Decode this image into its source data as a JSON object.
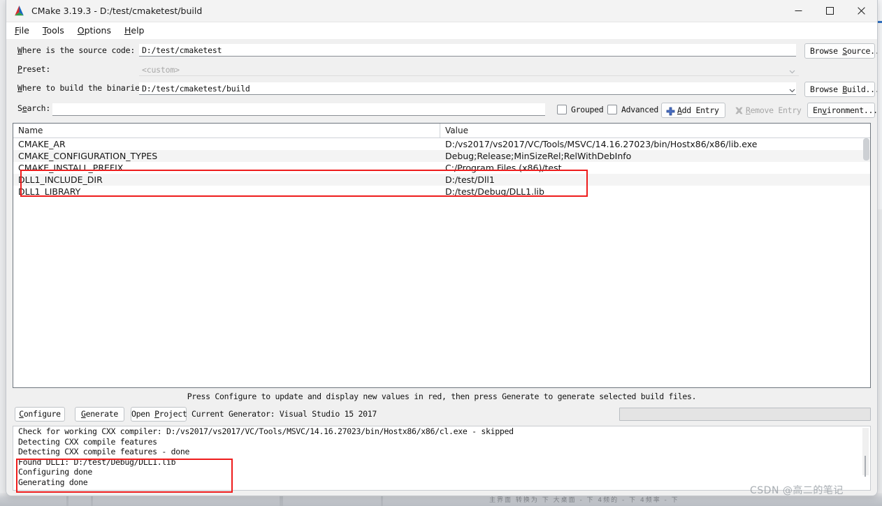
{
  "window": {
    "title": "CMake 3.19.3 - D:/test/cmaketest/build",
    "logo_icon": "cmake-triangle-logo",
    "minimize_icon": "minimize-icon",
    "maximize_icon": "maximize-icon",
    "close_icon": "close-icon"
  },
  "menubar": {
    "items": [
      {
        "label": "File",
        "mnemonic": "F"
      },
      {
        "label": "Tools",
        "mnemonic": "T"
      },
      {
        "label": "Options",
        "mnemonic": "O"
      },
      {
        "label": "Help",
        "mnemonic": "H"
      }
    ]
  },
  "form": {
    "source_label": "Where is the source code:",
    "source_label_pre": "",
    "source_label_mnemonic": "W",
    "source_label_post": "here is the source code:",
    "source_value": "D:/test/cmaketest",
    "preset_label": "Preset:",
    "preset_label_mnemonic": "P",
    "preset_label_post": "reset:",
    "preset_value": "<custom>",
    "build_label_mnemonic": "W",
    "build_label_post": "here to build the binaries:",
    "build_value": "D:/test/cmaketest/build",
    "search_label_pre": "S",
    "search_label_mnemonic": "e",
    "search_label_post": "arch:",
    "search_value": "",
    "search_placeholder": ""
  },
  "toolbar": {
    "browse_source_pre": "Browse ",
    "browse_source_mnemonic": "S",
    "browse_source_post": "ource...",
    "browse_build_pre": "Browse ",
    "browse_build_mnemonic": "B",
    "browse_build_post": "uild...",
    "grouped_label": "Grouped",
    "grouped_checked": false,
    "advanced_label": "Advanced",
    "advanced_checked": false,
    "add_entry_mnemonic": "A",
    "add_entry_post": "dd Entry",
    "add_entry_icon": "plus-icon",
    "remove_entry_mnemonic": "R",
    "remove_entry_post": "emove Entry",
    "remove_entry_icon": "remove-x-icon",
    "remove_entry_disabled": true,
    "environment_pre": "En",
    "environment_mnemonic": "v",
    "environment_post": "ironment...",
    "dropdown_icon": "chevron-down-icon"
  },
  "cache_table": {
    "columns": [
      "Name",
      "Value"
    ],
    "rows": [
      {
        "name": "CMAKE_AR",
        "value": "D:/vs2017/vs2017/VC/Tools/MSVC/14.16.27023/bin/Hostx86/x86/lib.exe",
        "alt": false,
        "highlighted": false
      },
      {
        "name": "CMAKE_CONFIGURATION_TYPES",
        "value": "Debug;Release;MinSizeRel;RelWithDebInfo",
        "alt": true,
        "highlighted": false
      },
      {
        "name": "CMAKE_INSTALL_PREFIX",
        "value": "C:/Program Files (x86)/test",
        "alt": false,
        "highlighted": false
      },
      {
        "name": "DLL1_INCLUDE_DIR",
        "value": "D:/test/Dll1",
        "alt": true,
        "highlighted": true
      },
      {
        "name": "DLL1_LIBRARY",
        "value": "D:/test/Debug/DLL1.lib",
        "alt": false,
        "highlighted": true
      }
    ]
  },
  "hint": {
    "text": "Press Configure to update and display new values in red, then press Generate to generate selected build files."
  },
  "actions": {
    "configure_mnemonic": "C",
    "configure_post": "onfigure",
    "generate_mnemonic": "G",
    "generate_post": "enerate",
    "open_project_pre": "Open ",
    "open_project_mnemonic": "P",
    "open_project_post": "roject",
    "generator_text": "Current Generator: Visual Studio 15 2017",
    "progress_value": 0
  },
  "log": {
    "lines": [
      "Check for working CXX compiler: D:/vs2017/vs2017/VC/Tools/MSVC/14.16.27023/bin/Hostx86/x86/cl.exe - skipped",
      "Detecting CXX compile features",
      "Detecting CXX compile features - done",
      "Found DLL1: D:/test/Debug/DLL1.lib",
      "Configuring done",
      "Generating done"
    ]
  },
  "annotations": {
    "highlight_color": "#ee1c1c",
    "table_box_label": "dll1-cache-entries-highlight",
    "log_box_label": "found-dll1-log-highlight"
  },
  "watermark": {
    "text": "CSDN @高二的笔记"
  },
  "background": {
    "bottom_text": "主界面 转换为 下 大桌面 - 下 4频的 - 下 4频率 - 下"
  }
}
